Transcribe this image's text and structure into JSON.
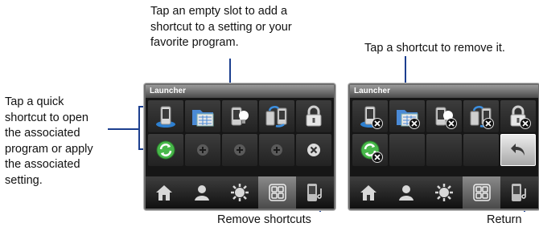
{
  "callouts": {
    "left": [
      "Tap a quick",
      "shortcut to open",
      "the associated",
      "program or apply",
      "the associated",
      "setting."
    ],
    "top_center": [
      "Tap an empty slot to add a",
      "shortcut to a setting or your",
      "favorite program."
    ],
    "top_right": "Tap a shortcut to remove it.",
    "bottom_center": "Remove shortcuts",
    "bottom_right": "Return"
  },
  "screen_left": {
    "title": "Launcher",
    "row1": [
      "phone-device-icon",
      "calendar-folder-icon",
      "light-bulb-icon",
      "sync-devices-icon",
      "padlock-icon"
    ],
    "row2": [
      "refresh-icon",
      "add-slot-icon",
      "add-slot-icon",
      "add-slot-icon",
      "remove-icon"
    ],
    "nav": [
      "home-icon",
      "people-icon",
      "settings-icon",
      "launcher-icon",
      "music-icon"
    ],
    "nav_active": 3
  },
  "screen_right": {
    "title": "Launcher",
    "row1": [
      "phone-device-icon",
      "calendar-folder-icon",
      "light-bulb-icon",
      "sync-devices-icon",
      "padlock-icon"
    ],
    "row2": [
      "refresh-icon",
      "empty-slot",
      "empty-slot",
      "empty-slot",
      "return-icon"
    ],
    "nav": [
      "home-icon",
      "people-icon",
      "settings-icon",
      "launcher-icon",
      "music-icon"
    ],
    "nav_active": 3
  },
  "colors": {
    "callout_line": "#1c3f8f",
    "screen_bg": "#161616",
    "titlebar": "#7a7a7a"
  }
}
